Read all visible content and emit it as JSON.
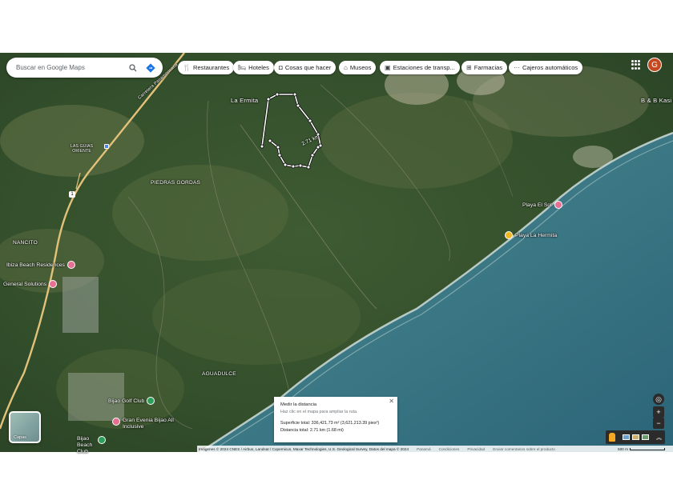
{
  "search": {
    "placeholder": "Buscar en Google Maps"
  },
  "chips": [
    {
      "icon": "restaurant-icon",
      "label": "Restaurantes"
    },
    {
      "icon": "hotel-icon",
      "label": "Hoteles"
    },
    {
      "icon": "camera-icon",
      "label": "Cosas que hacer"
    },
    {
      "icon": "museum-icon",
      "label": "Museos"
    },
    {
      "icon": "transit-icon",
      "label": "Estaciones de transp..."
    },
    {
      "icon": "pharmacy-icon",
      "label": "Farmacias"
    },
    {
      "icon": "more-icon",
      "label": "Cajeros automáticos"
    }
  ],
  "account": {
    "initial": "G"
  },
  "map_labels": {
    "la_ermita": "La Ermita",
    "las_guias_oriente": "LAS GUIAS\nORIENTE",
    "piedras_gordas": "PIEDRAS GORDAS",
    "nancito": "NANCITO",
    "aguadulce": "AGUADULCE",
    "bb_kasi": "B & B Kasi a",
    "road": "Carretera Panamericana",
    "route_shield": "1",
    "measured_distance": "2.71 km"
  },
  "pois": [
    {
      "name": "Ibiza Beach Residences",
      "color": "#e86f92"
    },
    {
      "name": "General Solutions",
      "color": "#e86f92"
    },
    {
      "name": "Playa El Sol",
      "color": "#e86f92"
    },
    {
      "name": "Playa La Hermita",
      "color": "#f2b623"
    },
    {
      "name": "Bijao Golf Club",
      "color": "#2e9e5b"
    },
    {
      "name": "Gran Evenia Bijao All Inclusive",
      "color": "#e86f92"
    },
    {
      "name": "Bijao Beach Club",
      "color": "#2e9e5b"
    }
  ],
  "layers": {
    "label": "Capas"
  },
  "measure_panel": {
    "title": "Medir la distancia",
    "subtitle": "Haz clic en el mapa para ampliar la ruta.",
    "area": "Superficie total: 336,421.73 m² (3,621,213.39 pies²)",
    "distance": "Distancia total: 2.71 km (1.68 mi)"
  },
  "footer": {
    "attribution": "Imágenes © 2024 CNES / Airbus, Landsat / Copernicus, Maxar Technologies, U.S. Geological Survey, Datos del mapa © 2024",
    "country": "Panamá",
    "terms": "Condiciones",
    "privacy": "Privacidad",
    "feedback": "Enviar comentarios sobre el producto",
    "scale": "500 m"
  }
}
